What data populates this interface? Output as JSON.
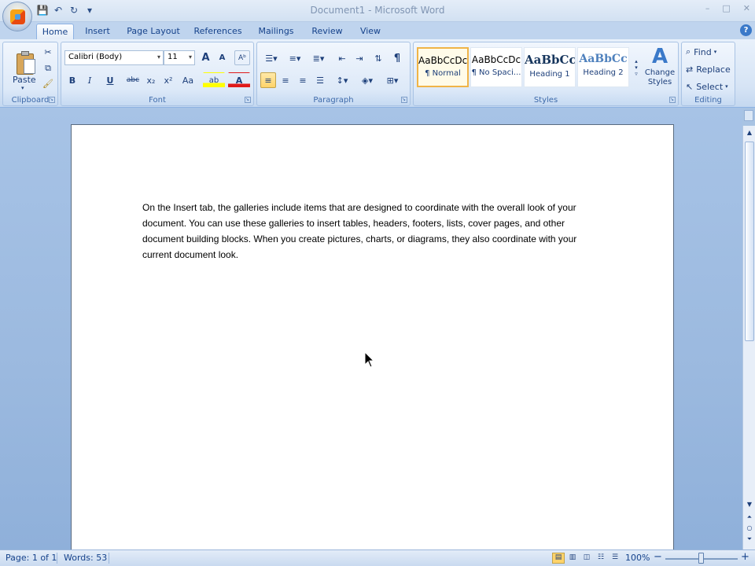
{
  "window": {
    "title": "Document1 - Microsoft Word",
    "controls": [
      "–",
      "□",
      "✕"
    ]
  },
  "quick_access": {
    "save_icon": "💾",
    "undo_icon": "↶",
    "redo_icon": "↻",
    "more_icon": "▾"
  },
  "tabs": [
    "Home",
    "Insert",
    "Page Layout",
    "References",
    "Mailings",
    "Review",
    "View"
  ],
  "active_tab": "Home",
  "ribbon": {
    "clipboard": {
      "label": "Clipboard",
      "paste_label": "Paste"
    },
    "font": {
      "label": "Font",
      "font_name": "Calibri (Body)",
      "font_size": "11",
      "bold": "B",
      "italic": "I",
      "underline": "U",
      "strikethrough": "abc",
      "subscript": "x₂",
      "superscript": "x²",
      "change_case": "Aa",
      "grow": "A",
      "shrink": "A",
      "highlight": "ab",
      "font_color": "A"
    },
    "paragraph": {
      "label": "Paragraph",
      "show_marks": "¶"
    },
    "styles": {
      "label": "Styles",
      "tiles": [
        {
          "sample": "AaBbCcDc",
          "name": "¶ Normal"
        },
        {
          "sample": "AaBbCcDc",
          "name": "¶ No Spaci..."
        },
        {
          "sample": "AaBbCc",
          "name": "Heading 1"
        },
        {
          "sample": "AaBbCc",
          "name": "Heading 2"
        }
      ],
      "change_styles_line1": "Change",
      "change_styles_line2": "Styles"
    },
    "editing": {
      "label": "Editing",
      "find": "Find",
      "replace": "Replace",
      "select": "Select"
    }
  },
  "document": {
    "body": "On the Insert tab, the galleries include items that are designed to coordinate with the overall look of your document. You can use these galleries to insert tables, headers, footers, lists, cover pages, and other document building blocks. When you create pictures, charts, or diagrams, they also coordinate with your current document look."
  },
  "status": {
    "page": "Page: 1 of 1",
    "words": "Words: 53",
    "zoom": "100%",
    "zoom_out": "−",
    "zoom_in": "+"
  },
  "colors": {
    "accent_highlight": "#ffd36a",
    "ribbon_text": "#15428b",
    "background": "#a8c3e3"
  }
}
